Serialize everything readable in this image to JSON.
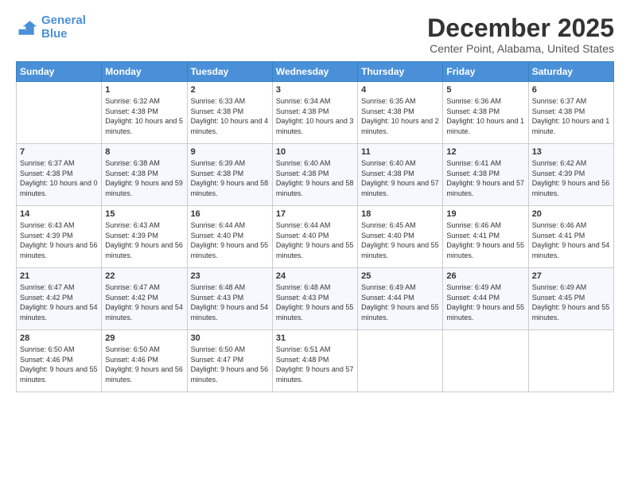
{
  "logo": {
    "line1": "General",
    "line2": "Blue"
  },
  "title": "December 2025",
  "location": "Center Point, Alabama, United States",
  "headers": [
    "Sunday",
    "Monday",
    "Tuesday",
    "Wednesday",
    "Thursday",
    "Friday",
    "Saturday"
  ],
  "weeks": [
    [
      {
        "day": "",
        "sunrise": "",
        "sunset": "",
        "daylight": ""
      },
      {
        "day": "1",
        "sunrise": "Sunrise: 6:32 AM",
        "sunset": "Sunset: 4:38 PM",
        "daylight": "Daylight: 10 hours and 5 minutes."
      },
      {
        "day": "2",
        "sunrise": "Sunrise: 6:33 AM",
        "sunset": "Sunset: 4:38 PM",
        "daylight": "Daylight: 10 hours and 4 minutes."
      },
      {
        "day": "3",
        "sunrise": "Sunrise: 6:34 AM",
        "sunset": "Sunset: 4:38 PM",
        "daylight": "Daylight: 10 hours and 3 minutes."
      },
      {
        "day": "4",
        "sunrise": "Sunrise: 6:35 AM",
        "sunset": "Sunset: 4:38 PM",
        "daylight": "Daylight: 10 hours and 2 minutes."
      },
      {
        "day": "5",
        "sunrise": "Sunrise: 6:36 AM",
        "sunset": "Sunset: 4:38 PM",
        "daylight": "Daylight: 10 hours and 1 minute."
      },
      {
        "day": "6",
        "sunrise": "Sunrise: 6:37 AM",
        "sunset": "Sunset: 4:38 PM",
        "daylight": "Daylight: 10 hours and 1 minute."
      }
    ],
    [
      {
        "day": "7",
        "sunrise": "Sunrise: 6:37 AM",
        "sunset": "Sunset: 4:38 PM",
        "daylight": "Daylight: 10 hours and 0 minutes."
      },
      {
        "day": "8",
        "sunrise": "Sunrise: 6:38 AM",
        "sunset": "Sunset: 4:38 PM",
        "daylight": "Daylight: 9 hours and 59 minutes."
      },
      {
        "day": "9",
        "sunrise": "Sunrise: 6:39 AM",
        "sunset": "Sunset: 4:38 PM",
        "daylight": "Daylight: 9 hours and 58 minutes."
      },
      {
        "day": "10",
        "sunrise": "Sunrise: 6:40 AM",
        "sunset": "Sunset: 4:38 PM",
        "daylight": "Daylight: 9 hours and 58 minutes."
      },
      {
        "day": "11",
        "sunrise": "Sunrise: 6:40 AM",
        "sunset": "Sunset: 4:38 PM",
        "daylight": "Daylight: 9 hours and 57 minutes."
      },
      {
        "day": "12",
        "sunrise": "Sunrise: 6:41 AM",
        "sunset": "Sunset: 4:38 PM",
        "daylight": "Daylight: 9 hours and 57 minutes."
      },
      {
        "day": "13",
        "sunrise": "Sunrise: 6:42 AM",
        "sunset": "Sunset: 4:39 PM",
        "daylight": "Daylight: 9 hours and 56 minutes."
      }
    ],
    [
      {
        "day": "14",
        "sunrise": "Sunrise: 6:43 AM",
        "sunset": "Sunset: 4:39 PM",
        "daylight": "Daylight: 9 hours and 56 minutes."
      },
      {
        "day": "15",
        "sunrise": "Sunrise: 6:43 AM",
        "sunset": "Sunset: 4:39 PM",
        "daylight": "Daylight: 9 hours and 56 minutes."
      },
      {
        "day": "16",
        "sunrise": "Sunrise: 6:44 AM",
        "sunset": "Sunset: 4:40 PM",
        "daylight": "Daylight: 9 hours and 55 minutes."
      },
      {
        "day": "17",
        "sunrise": "Sunrise: 6:44 AM",
        "sunset": "Sunset: 4:40 PM",
        "daylight": "Daylight: 9 hours and 55 minutes."
      },
      {
        "day": "18",
        "sunrise": "Sunrise: 6:45 AM",
        "sunset": "Sunset: 4:40 PM",
        "daylight": "Daylight: 9 hours and 55 minutes."
      },
      {
        "day": "19",
        "sunrise": "Sunrise: 6:46 AM",
        "sunset": "Sunset: 4:41 PM",
        "daylight": "Daylight: 9 hours and 55 minutes."
      },
      {
        "day": "20",
        "sunrise": "Sunrise: 6:46 AM",
        "sunset": "Sunset: 4:41 PM",
        "daylight": "Daylight: 9 hours and 54 minutes."
      }
    ],
    [
      {
        "day": "21",
        "sunrise": "Sunrise: 6:47 AM",
        "sunset": "Sunset: 4:42 PM",
        "daylight": "Daylight: 9 hours and 54 minutes."
      },
      {
        "day": "22",
        "sunrise": "Sunrise: 6:47 AM",
        "sunset": "Sunset: 4:42 PM",
        "daylight": "Daylight: 9 hours and 54 minutes."
      },
      {
        "day": "23",
        "sunrise": "Sunrise: 6:48 AM",
        "sunset": "Sunset: 4:43 PM",
        "daylight": "Daylight: 9 hours and 54 minutes."
      },
      {
        "day": "24",
        "sunrise": "Sunrise: 6:48 AM",
        "sunset": "Sunset: 4:43 PM",
        "daylight": "Daylight: 9 hours and 55 minutes."
      },
      {
        "day": "25",
        "sunrise": "Sunrise: 6:49 AM",
        "sunset": "Sunset: 4:44 PM",
        "daylight": "Daylight: 9 hours and 55 minutes."
      },
      {
        "day": "26",
        "sunrise": "Sunrise: 6:49 AM",
        "sunset": "Sunset: 4:44 PM",
        "daylight": "Daylight: 9 hours and 55 minutes."
      },
      {
        "day": "27",
        "sunrise": "Sunrise: 6:49 AM",
        "sunset": "Sunset: 4:45 PM",
        "daylight": "Daylight: 9 hours and 55 minutes."
      }
    ],
    [
      {
        "day": "28",
        "sunrise": "Sunrise: 6:50 AM",
        "sunset": "Sunset: 4:46 PM",
        "daylight": "Daylight: 9 hours and 55 minutes."
      },
      {
        "day": "29",
        "sunrise": "Sunrise: 6:50 AM",
        "sunset": "Sunset: 4:46 PM",
        "daylight": "Daylight: 9 hours and 56 minutes."
      },
      {
        "day": "30",
        "sunrise": "Sunrise: 6:50 AM",
        "sunset": "Sunset: 4:47 PM",
        "daylight": "Daylight: 9 hours and 56 minutes."
      },
      {
        "day": "31",
        "sunrise": "Sunrise: 6:51 AM",
        "sunset": "Sunset: 4:48 PM",
        "daylight": "Daylight: 9 hours and 57 minutes."
      },
      {
        "day": "",
        "sunrise": "",
        "sunset": "",
        "daylight": ""
      },
      {
        "day": "",
        "sunrise": "",
        "sunset": "",
        "daylight": ""
      },
      {
        "day": "",
        "sunrise": "",
        "sunset": "",
        "daylight": ""
      }
    ]
  ]
}
